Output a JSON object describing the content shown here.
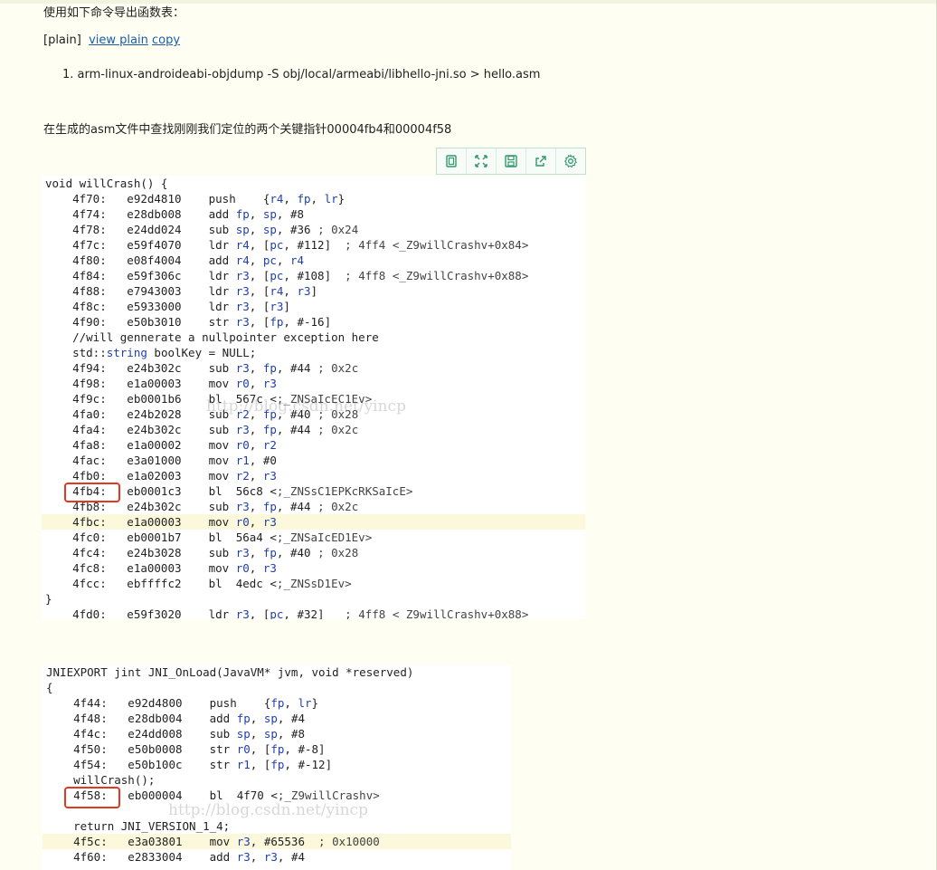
{
  "intro_text": "使用如下命令导出函数表：",
  "code_tag": "[plain]",
  "view_plain_label": "view plain",
  "copy_label": "copy",
  "command_number": "1.",
  "command_text": "arm-linux-androideabi-objdump -S obj/local/armeabi/libhello-jni.so > hello.asm",
  "search_text": "在生成的asm文件中查找刚刚我们定位的两个关键指针00004fb4和00004f58",
  "toolbar_icons": [
    "copy-icon",
    "expand-icon",
    "save-icon",
    "share-icon",
    "gear-icon"
  ],
  "watermark": "http://blog.csdn.net/yincp",
  "accent_color": "#e03a1e",
  "block1": {
    "lines": [
      "void willCrash() {",
      "    4f70:   e92d4810    push    {r4, fp, lr}",
      "    4f74:   e28db008    add fp, sp, #8",
      "    4f78:   e24dd024    sub sp, sp, #36 ; 0x24",
      "    4f7c:   e59f4070    ldr r4, [pc, #112]  ; 4ff4 <_Z9willCrashv+0x84>",
      "    4f80:   e08f4004    add r4, pc, r4",
      "    4f84:   e59f306c    ldr r3, [pc, #108]  ; 4ff8 <_Z9willCrashv+0x88>",
      "    4f88:   e7943003    ldr r3, [r4, r3]",
      "    4f8c:   e5933000    ldr r3, [r3]",
      "    4f90:   e50b3010    str r3, [fp, #-16]",
      "    //will gennerate a nullpointer exception here",
      "    std::string boolKey = NULL;",
      "    4f94:   e24b302c    sub r3, fp, #44 ; 0x2c",
      "    4f98:   e1a00003    mov r0, r3",
      "    4f9c:   eb0001b6    bl  567c <_ZNSaIcEC1Ev>",
      "    4fa0:   e24b2028    sub r2, fp, #40 ; 0x28",
      "    4fa4:   e24b302c    sub r3, fp, #44 ; 0x2c",
      "    4fa8:   e1a00002    mov r0, r2",
      "    4fac:   e3a01000    mov r1, #0",
      "    4fb0:   e1a02003    mov r2, r3",
      "    4fb4:   eb0001c3    bl  56c8 <_ZNSsC1EPKcRKSaIcE>",
      "    4fb8:   e24b302c    sub r3, fp, #44 ; 0x2c",
      "    4fbc:   e1a00003    mov r0, r3",
      "    4fc0:   eb0001b7    bl  56a4 <_ZNSaIcED1Ev>",
      "    4fc4:   e24b3028    sub r3, fp, #40 ; 0x28",
      "    4fc8:   e1a00003    mov r0, r3",
      "    4fcc:   ebffffc2    bl  4edc <_ZNSsD1Ev>",
      "}",
      "    4fd0:   e59f3020    ldr r3, [pc, #32]   ; 4ff8 <_Z9willCrashv+0x88>"
    ]
  },
  "block2": {
    "lines": [
      "JNIEXPORT jint JNI_OnLoad(JavaVM* jvm, void *reserved)",
      "{",
      "    4f44:   e92d4800    push    {fp, lr}",
      "    4f48:   e28db004    add fp, sp, #4",
      "    4f4c:   e24dd008    sub sp, sp, #8",
      "    4f50:   e50b0008    str r0, [fp, #-8]",
      "    4f54:   e50b100c    str r1, [fp, #-12]",
      "    willCrash();",
      "    4f58:   eb000004    bl  4f70 <_Z9willCrashv>",
      "",
      "    return JNI_VERSION_1_4;",
      "    4f5c:   e3a03801    mov r3, #65536  ; 0x10000",
      "    4f60:   e2833004    add r3, r3, #4"
    ]
  }
}
